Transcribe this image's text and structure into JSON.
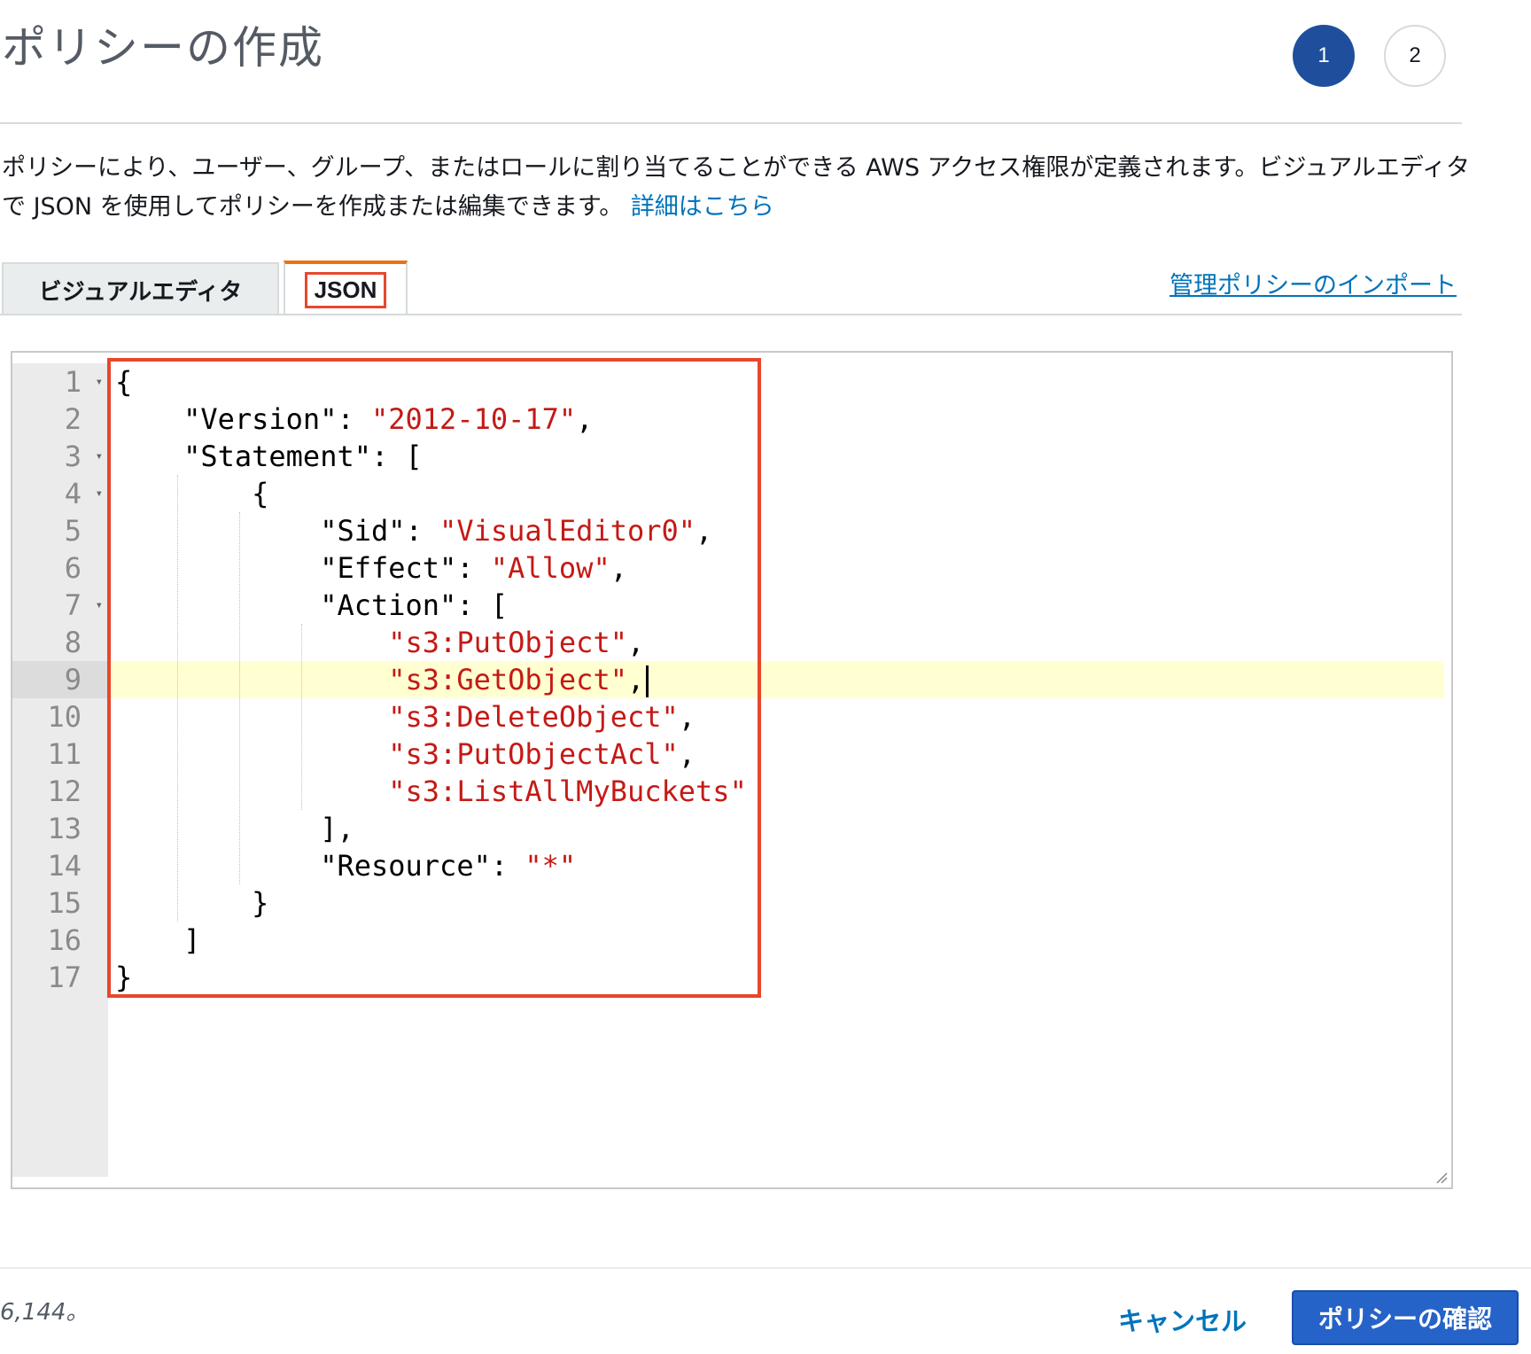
{
  "page": {
    "title": "ポリシーの作成",
    "steps": [
      "1",
      "2"
    ],
    "description": "ポリシーにより、ユーザー、グループ、またはロールに割り当てることができる AWS アクセス権限が定義されます。ビジュアルエディタで JSON を使用してポリシーを作成または編集できます。",
    "learn_more": "詳細はこちら"
  },
  "tabs": {
    "visual_editor": "ビジュアルエディタ",
    "json": "JSON",
    "active": "json"
  },
  "import_link": "管理ポリシーのインポート",
  "editor": {
    "lines": [
      {
        "no": "1",
        "indent": "",
        "parts": [
          [
            "p",
            "{"
          ]
        ]
      },
      {
        "no": "2",
        "indent": "    ",
        "parts": [
          [
            "p",
            "\"Version\": "
          ],
          [
            "s",
            "\"2012-10-17\""
          ],
          [
            "p",
            ","
          ]
        ]
      },
      {
        "no": "3",
        "indent": "    ",
        "parts": [
          [
            "p",
            "\"Statement\": ["
          ]
        ]
      },
      {
        "no": "4",
        "indent": "        ",
        "parts": [
          [
            "p",
            "{"
          ]
        ]
      },
      {
        "no": "5",
        "indent": "            ",
        "parts": [
          [
            "p",
            "\"Sid\": "
          ],
          [
            "s",
            "\"VisualEditor0\""
          ],
          [
            "p",
            ","
          ]
        ]
      },
      {
        "no": "6",
        "indent": "            ",
        "parts": [
          [
            "p",
            "\"Effect\": "
          ],
          [
            "s",
            "\"Allow\""
          ],
          [
            "p",
            ","
          ]
        ]
      },
      {
        "no": "7",
        "indent": "            ",
        "parts": [
          [
            "p",
            "\"Action\": ["
          ]
        ]
      },
      {
        "no": "8",
        "indent": "                ",
        "parts": [
          [
            "s",
            "\"s3:PutObject\""
          ],
          [
            "p",
            ","
          ]
        ]
      },
      {
        "no": "9",
        "indent": "                ",
        "parts": [
          [
            "s",
            "\"s3:GetObject\""
          ],
          [
            "p",
            ","
          ]
        ]
      },
      {
        "no": "10",
        "indent": "                ",
        "parts": [
          [
            "s",
            "\"s3:DeleteObject\""
          ],
          [
            "p",
            ","
          ]
        ]
      },
      {
        "no": "11",
        "indent": "                ",
        "parts": [
          [
            "s",
            "\"s3:PutObjectAcl\""
          ],
          [
            "p",
            ","
          ]
        ]
      },
      {
        "no": "12",
        "indent": "                ",
        "parts": [
          [
            "s",
            "\"s3:ListAllMyBuckets\""
          ]
        ]
      },
      {
        "no": "13",
        "indent": "            ",
        "parts": [
          [
            "p",
            "],"
          ]
        ]
      },
      {
        "no": "14",
        "indent": "            ",
        "parts": [
          [
            "p",
            "\"Resource\": "
          ],
          [
            "s",
            "\"*\""
          ]
        ]
      },
      {
        "no": "15",
        "indent": "        ",
        "parts": [
          [
            "p",
            "}"
          ]
        ]
      },
      {
        "no": "16",
        "indent": "    ",
        "parts": [
          [
            "p",
            "]"
          ]
        ]
      },
      {
        "no": "17",
        "indent": "",
        "parts": [
          [
            "p",
            "}"
          ]
        ]
      }
    ],
    "foldable_lines": [
      "1",
      "3",
      "4",
      "7"
    ],
    "active_line": "9"
  },
  "footer": {
    "char_count": "6,144。",
    "cancel_label": "キャンセル",
    "review_label": "ポリシーの確認"
  },
  "colors": {
    "primary": "#2563c8",
    "link": "#0073bb",
    "string": "#c41a16",
    "highlight_border": "#e8472c",
    "active_tab_accent": "#ec7211"
  }
}
